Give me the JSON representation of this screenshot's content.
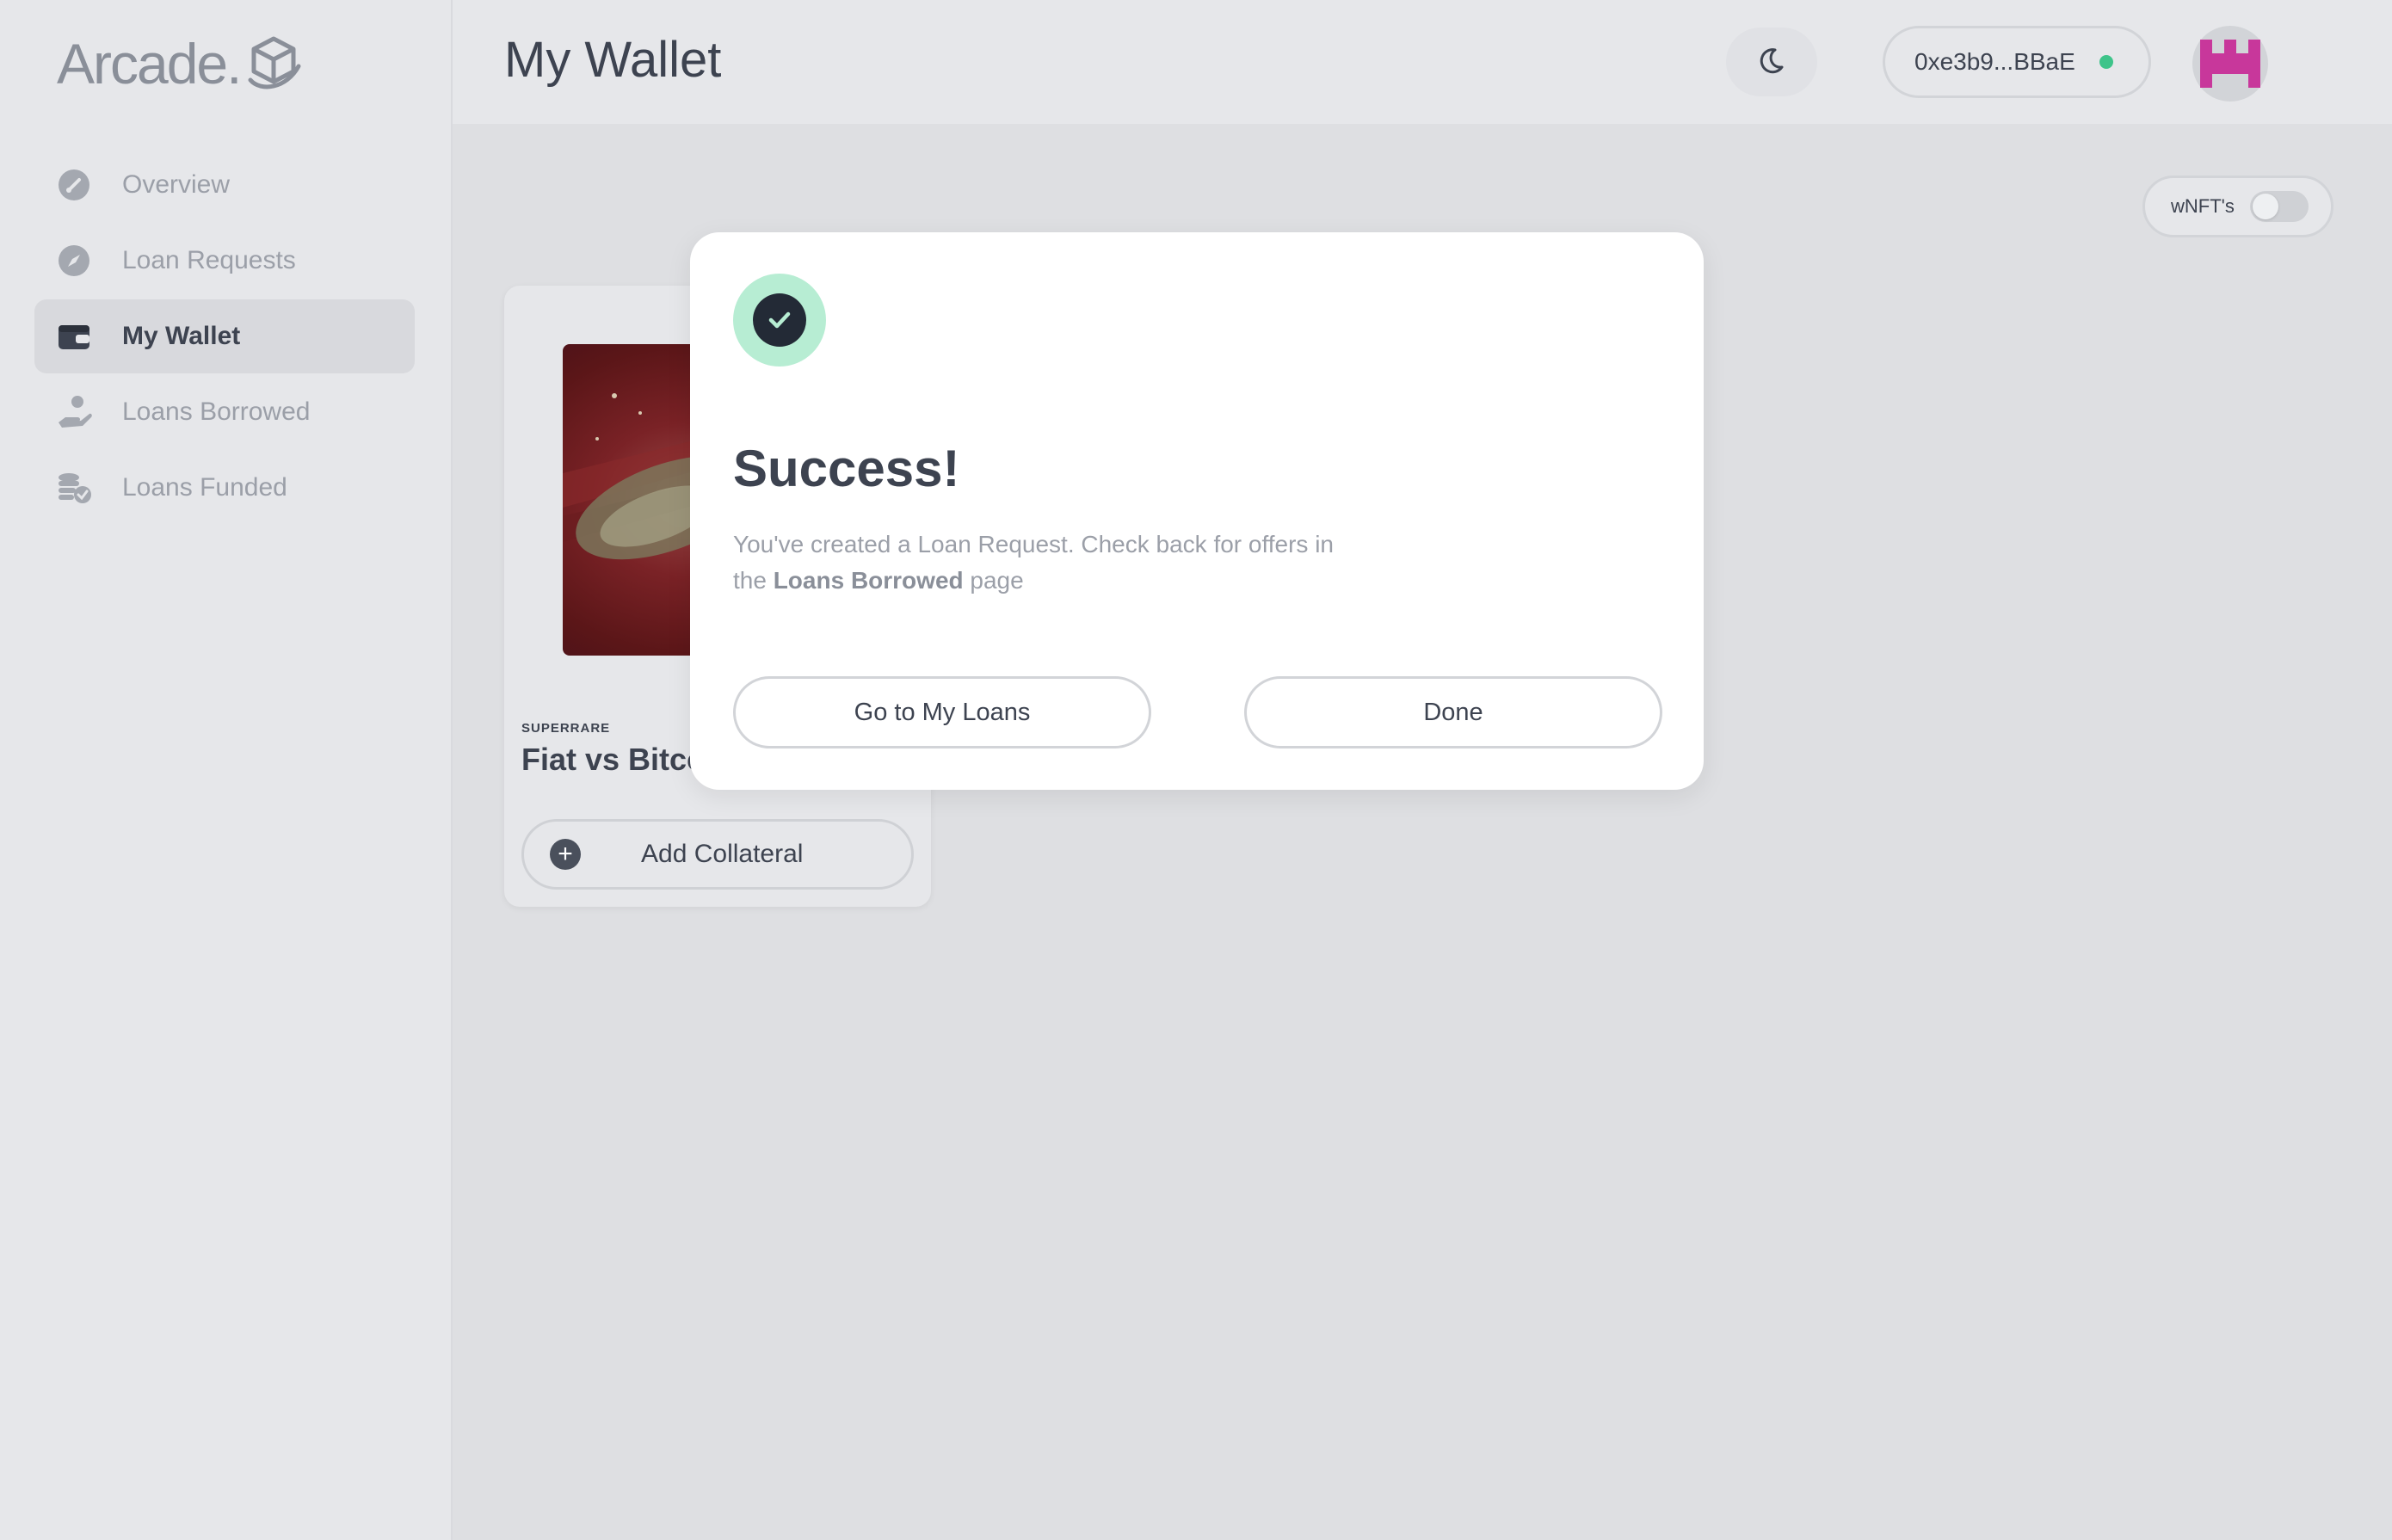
{
  "app": {
    "logo_text": "Arcade."
  },
  "sidebar": {
    "items": [
      {
        "label": "Overview",
        "icon": "gauge-icon"
      },
      {
        "label": "Loan Requests",
        "icon": "compass-icon"
      },
      {
        "label": "My Wallet",
        "icon": "wallet-icon",
        "active": true
      },
      {
        "label": "Loans Borrowed",
        "icon": "hand-coin-icon"
      },
      {
        "label": "Loans Funded",
        "icon": "coins-check-icon"
      }
    ]
  },
  "header": {
    "title": "My Wallet",
    "wallet_address": "0xe3b9...BBaE",
    "status_color": "#3ec48a"
  },
  "filter": {
    "wnft_label": "wNFT's",
    "wnft_enabled": false
  },
  "card": {
    "collection": "SUPERRARE",
    "title": "Fiat vs Bitco",
    "add_collateral_label": "Add Collateral"
  },
  "modal": {
    "title": "Success!",
    "message_part1": "You've created a Loan Request. Check back for offers in the ",
    "message_bold": "Loans Borrowed",
    "message_part2": " page",
    "primary_button": "Go to My Loans",
    "secondary_button": "Done"
  }
}
